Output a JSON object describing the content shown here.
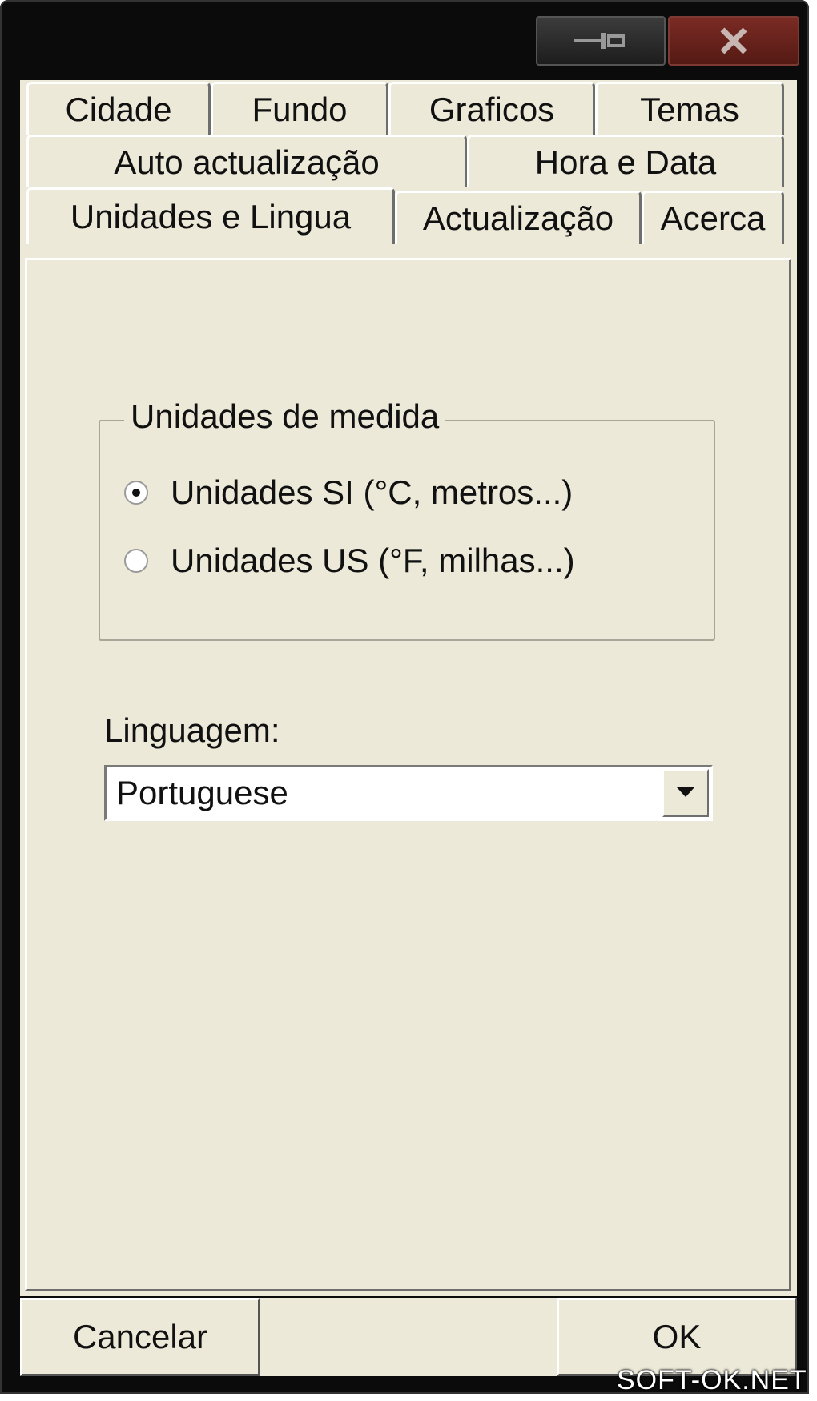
{
  "titlebar": {
    "pin_icon": "pin-icon",
    "close_icon": "close-icon"
  },
  "tabs": {
    "row1": [
      {
        "label": "Cidade"
      },
      {
        "label": "Fundo"
      },
      {
        "label": "Graficos"
      },
      {
        "label": "Temas"
      }
    ],
    "row2": [
      {
        "label": "Auto actualização"
      },
      {
        "label": "Hora e Data"
      }
    ],
    "row3": [
      {
        "label": "Unidades e Lingua",
        "active": true
      },
      {
        "label": "Actualização"
      },
      {
        "label": "Acerca"
      }
    ]
  },
  "units": {
    "legend": "Unidades de medida",
    "options": [
      {
        "label": "Unidades SI (°C, metros...)",
        "checked": true
      },
      {
        "label": "Unidades US (°F, milhas...)",
        "checked": false
      }
    ]
  },
  "language": {
    "label": "Linguagem:",
    "selected": "Portuguese"
  },
  "buttons": {
    "cancel": "Cancelar",
    "ok": "OK"
  },
  "watermark": "SOFT-OK.NET"
}
